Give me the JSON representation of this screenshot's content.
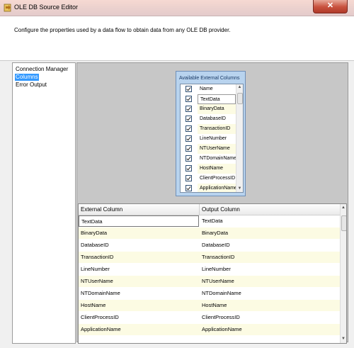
{
  "window": {
    "title": "OLE DB Source Editor"
  },
  "header": {
    "description": "Configure the properties used by a data flow to obtain data from any OLE DB provider."
  },
  "nav": {
    "items": [
      {
        "label": "Connection Manager"
      },
      {
        "label": "Columns",
        "selected": true
      },
      {
        "label": "Error Output"
      }
    ]
  },
  "available_columns": {
    "title": "Available External Columns",
    "header_label": "Name",
    "items": [
      {
        "label": "TextData",
        "checked": true
      },
      {
        "label": "BinaryData",
        "checked": true
      },
      {
        "label": "DatabaseID",
        "checked": true
      },
      {
        "label": "TransactionID",
        "checked": true
      },
      {
        "label": "LineNumber",
        "checked": true
      },
      {
        "label": "NTUserName",
        "checked": true
      },
      {
        "label": "NTDomainName",
        "checked": true
      },
      {
        "label": "HostName",
        "checked": true
      },
      {
        "label": "ClientProcessID",
        "checked": true
      },
      {
        "label": "ApplicationName",
        "checked": true
      }
    ]
  },
  "mapping_grid": {
    "columns": [
      "External Column",
      "Output Column"
    ],
    "rows": [
      [
        "TextData",
        "TextData"
      ],
      [
        "BinaryData",
        "BinaryData"
      ],
      [
        "DatabaseID",
        "DatabaseID"
      ],
      [
        "TransactionID",
        "TransactionID"
      ],
      [
        "LineNumber",
        "LineNumber"
      ],
      [
        "NTUserName",
        "NTUserName"
      ],
      [
        "NTDomainName",
        "NTDomainName"
      ],
      [
        "HostName",
        "HostName"
      ],
      [
        "ClientProcessID",
        "ClientProcessID"
      ],
      [
        "ApplicationName",
        "ApplicationName"
      ]
    ]
  },
  "colors": {
    "row_highlight": "#fcfbe3",
    "selected_nav": "#3399ff",
    "close_button": "#c8513d"
  }
}
